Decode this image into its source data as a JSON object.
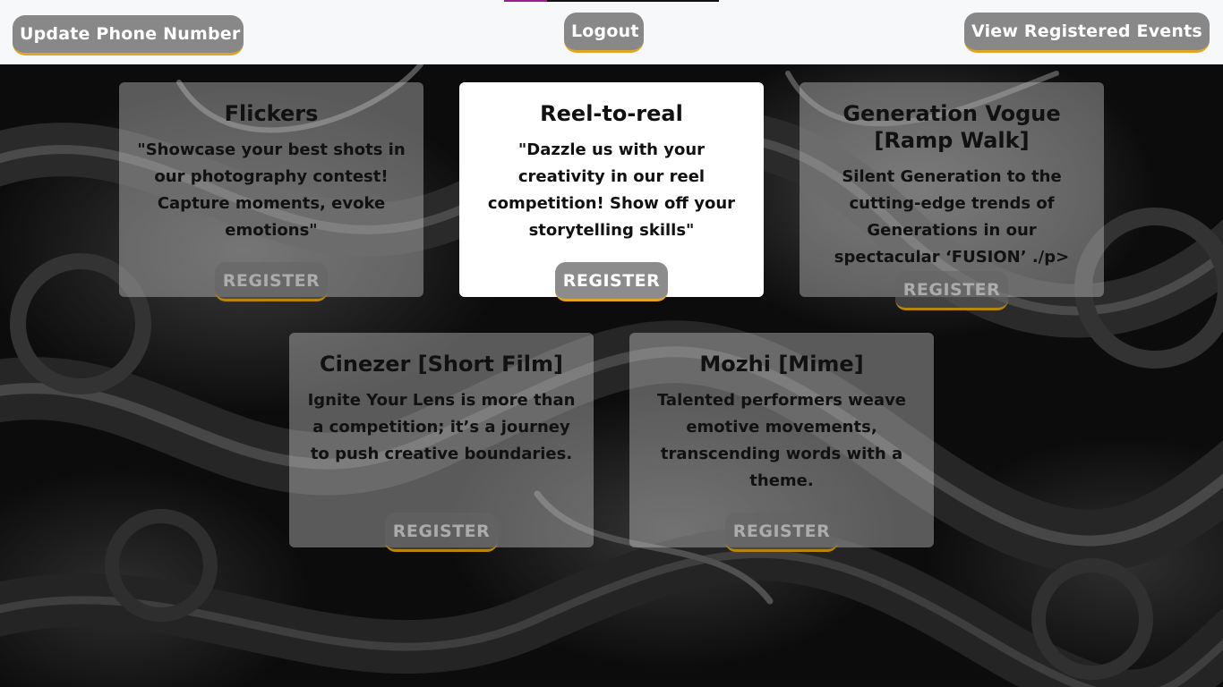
{
  "header": {
    "update_phone_label": "Update Phone Number",
    "logout_label": "Logout",
    "view_registered_label": "View Registered Events"
  },
  "events": [
    {
      "title": "Flickers",
      "description": "\"Showcase your best shots in our photography contest! Capture moments, evoke emotions\"",
      "button_label": "REGISTER"
    },
    {
      "title": "Reel-to-real",
      "description": "\"Dazzle us with your creativity in our reel competition! Show off your storytelling skills\"",
      "button_label": "REGISTER"
    },
    {
      "title": "Generation Vogue [Ramp Walk]",
      "description": "Silent Generation to the cutting-edge trends of Generations in our spectacular ‘FUSION’ ./p>",
      "button_label": "REGISTER"
    },
    {
      "title": "Cinezer [Short Film]",
      "description": "Ignite Your Lens is more than a competition; it’s a journey to push creative boundaries.",
      "button_label": "REGISTER"
    },
    {
      "title": "Mozhi [Mime]",
      "description": "Talented performers weave emotive movements, transcending words with a theme.",
      "button_label": "REGISTER"
    }
  ],
  "colors": {
    "button_bg": "#888888",
    "button_underline": "#e0a526",
    "topbar_bg": "#f7f8fa",
    "card_bg": "rgba(200,200,200,0.42)"
  }
}
